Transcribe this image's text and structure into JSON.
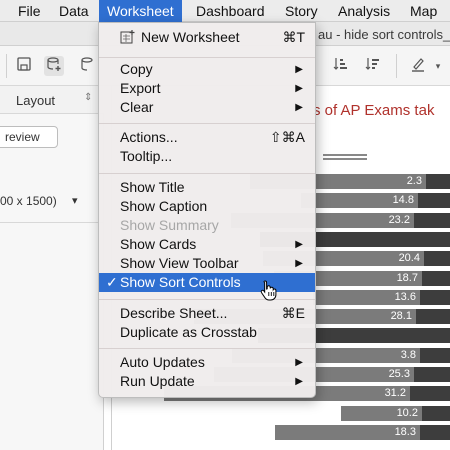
{
  "menubar": {
    "items": [
      "File",
      "Data",
      "Worksheet",
      "Dashboard",
      "Story",
      "Analysis",
      "Map"
    ],
    "active": "Worksheet"
  },
  "window": {
    "title_fragment": "au - hide sort controls_"
  },
  "left_panel": {
    "layout_label": "Layout",
    "preview_label": "review",
    "size_label": "00 x 1500)"
  },
  "chart": {
    "title_fragment": "s of AP Exams tak"
  },
  "chart_data": {
    "type": "bar",
    "title": "s of AP Exams tak",
    "values": [
      22.3,
      14.8,
      23.2,
      null,
      20.4,
      18.7,
      13.6,
      28.1,
      null,
      23.8,
      25.3,
      31.2,
      10.2,
      18.3
    ],
    "labels": [
      "2.3",
      "14.8",
      "23.2",
      "",
      "20.4",
      "18.7",
      "13.6",
      "28.1",
      "",
      "3.8",
      "25.3",
      "31.2",
      "10.2",
      "18.3"
    ],
    "colors": {
      "light": "#7b7b7b",
      "dark": "#3d3d3d"
    }
  },
  "menu": {
    "new_worksheet": {
      "label": "New Worksheet",
      "shortcut": "⌘T",
      "icon": "new-worksheet-icon"
    },
    "copy": {
      "label": "Copy"
    },
    "export": {
      "label": "Export"
    },
    "clear": {
      "label": "Clear"
    },
    "actions": {
      "label": "Actions...",
      "shortcut": "⇧⌘A"
    },
    "tooltip": {
      "label": "Tooltip..."
    },
    "show_title": {
      "label": "Show Title"
    },
    "show_caption": {
      "label": "Show Caption"
    },
    "show_summary": {
      "label": "Show Summary"
    },
    "show_cards": {
      "label": "Show Cards"
    },
    "show_view_toolbar": {
      "label": "Show View Toolbar"
    },
    "show_sort_controls": {
      "label": "Show Sort Controls",
      "checked": true,
      "check": "✓"
    },
    "describe_sheet": {
      "label": "Describe Sheet...",
      "shortcut": "⌘E"
    },
    "duplicate_crosstab": {
      "label": "Duplicate as Crosstab"
    },
    "auto_updates": {
      "label": "Auto Updates"
    },
    "run_update": {
      "label": "Run Update"
    }
  },
  "colors": {
    "accent": "#2f6fd1",
    "title_red": "#b0322c"
  }
}
